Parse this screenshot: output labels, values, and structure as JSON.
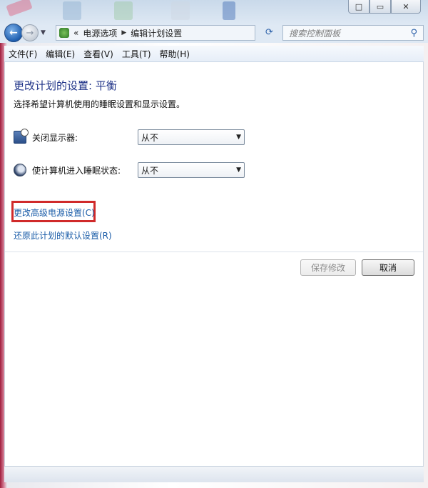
{
  "window": {
    "caption_min": "□",
    "caption_max": "▭",
    "caption_close": "✕"
  },
  "address": {
    "chevrons": "«",
    "crumbs": [
      "电源选项",
      "编辑计划设置"
    ],
    "search_placeholder": "搜索控制面板"
  },
  "menu": [
    "文件(F)",
    "编辑(E)",
    "查看(V)",
    "工具(T)",
    "帮助(H)"
  ],
  "page": {
    "heading": "更改计划的设置: 平衡",
    "description": "选择希望计算机使用的睡眠设置和显示设置。",
    "settings": [
      {
        "label": "关闭显示器:",
        "value": "从不",
        "icon": "monitor-icon"
      },
      {
        "label": "使计算机进入睡眠状态:",
        "value": "从不",
        "icon": "sleep-moon-icon"
      }
    ],
    "links": {
      "advanced": "更改高级电源设置(C)",
      "restore": "还原此计划的默认设置(R)"
    },
    "buttons": {
      "save": "保存修改",
      "cancel": "取消"
    }
  },
  "colors": {
    "heading": "#1e3287",
    "link": "#1a5ca8",
    "highlight": "#d02a2a"
  }
}
